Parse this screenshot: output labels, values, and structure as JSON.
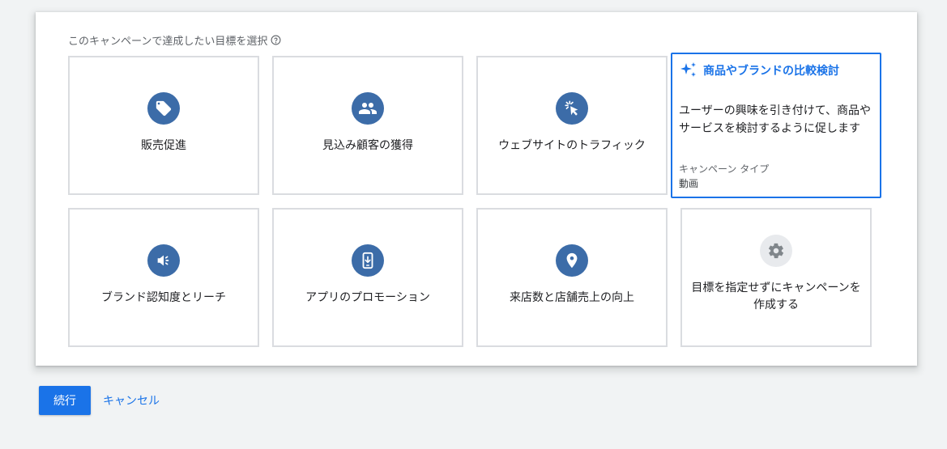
{
  "heading": "このキャンペーンで達成したい目標を選択",
  "goals": [
    {
      "label": "販売促進",
      "icon": "tag-icon"
    },
    {
      "label": "見込み顧客の獲得",
      "icon": "people-icon"
    },
    {
      "label": "ウェブサイトのトラフィック",
      "icon": "cursor-click-icon"
    },
    {
      "label": "ブランド認知度とリーチ",
      "icon": "megaphone-icon"
    },
    {
      "label": "アプリのプロモーション",
      "icon": "phone-download-icon"
    },
    {
      "label": "来店数と店舗売上の向上",
      "icon": "location-pin-icon"
    },
    {
      "label": "目標を指定せずにキャンペーンを作成する",
      "icon": "gear-icon"
    }
  ],
  "selected_goal": {
    "title": "商品やブランドの比較検討",
    "icon": "sparkle-icon",
    "description": "ユーザーの興味を引き付けて、商品やサービスを検討するように促します",
    "campaign_type_label": "キャンペーン タイプ",
    "campaign_type_value": "動画"
  },
  "buttons": {
    "continue": "続行",
    "cancel": "キャンセル"
  },
  "colors": {
    "accent": "#1a73e8",
    "icon_circle": "#3c6ca8",
    "card_border": "#dadce0"
  }
}
